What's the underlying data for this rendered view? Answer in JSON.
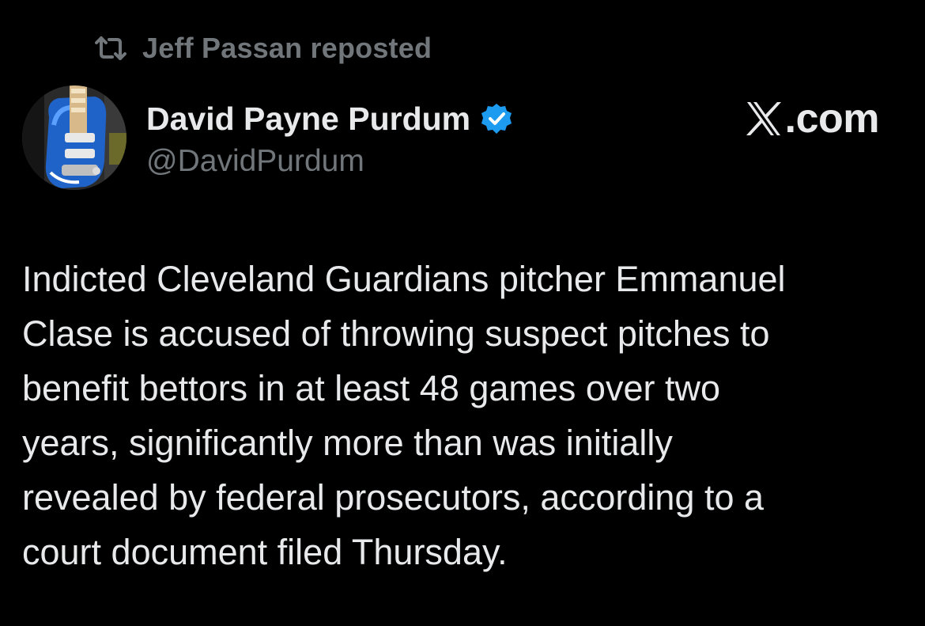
{
  "repost": {
    "label": "Jeff Passan reposted",
    "icon": "repost-icon"
  },
  "author": {
    "display_name": "David Payne Purdum",
    "handle": "@DavidPurdum",
    "verified": true,
    "verified_color": "#1d9bf0",
    "avatar": "guitar-avatar"
  },
  "brand": {
    "label": ".com",
    "logo": "x-logo-icon"
  },
  "tweet": {
    "text": "Indicted Cleveland Guardians pitcher Emmanuel\nClase is accused of throwing suspect pitches to\nbenefit bettors in at least 48 games over two\nyears, significantly more than was initially\nrevealed by federal prosecutors, according to a\ncourt document filed Thursday."
  },
  "colors": {
    "background": "#000000",
    "primary_text": "#e7e9ea",
    "secondary_text": "#71767b"
  }
}
